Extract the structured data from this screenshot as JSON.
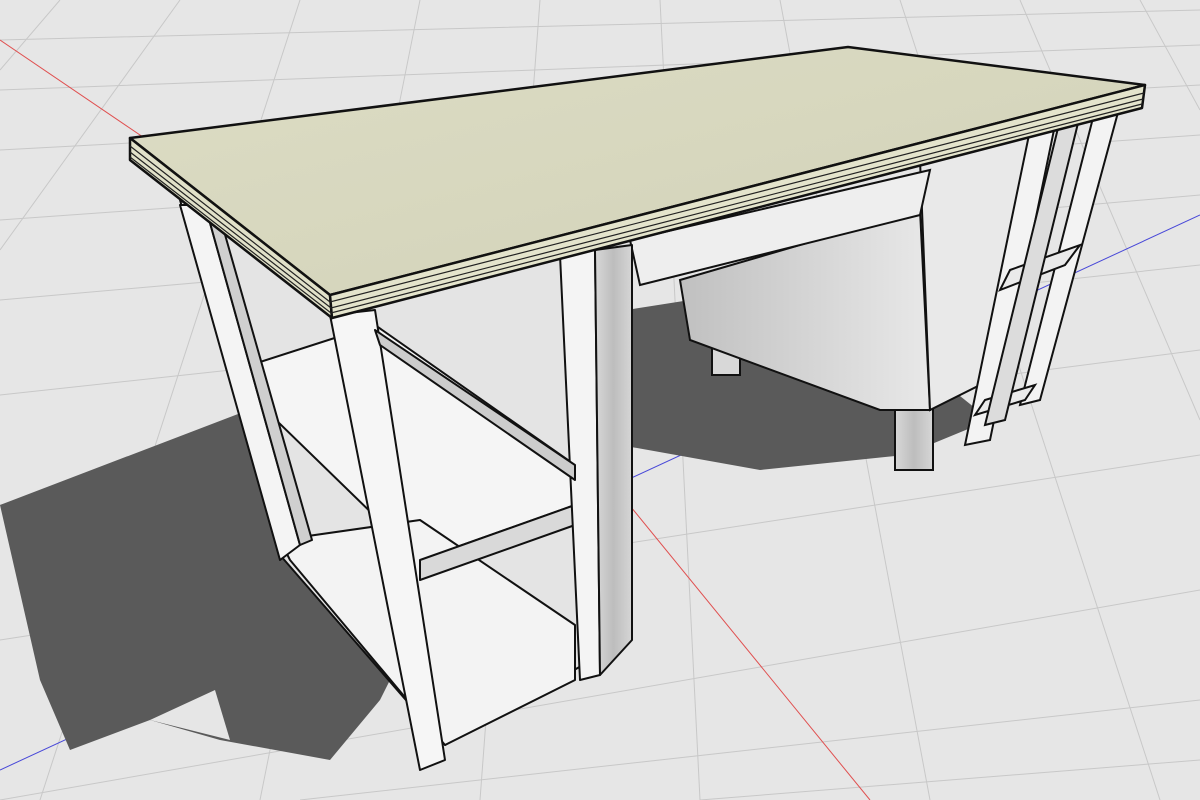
{
  "scene": {
    "object": "desk-model",
    "view": "3d-perspective",
    "colors": {
      "background": "#e6e6e6",
      "grid": "#c9c9c9",
      "axis_red": "#e05050",
      "axis_blue": "#4848d8",
      "shadow": "#595959",
      "desktop": "#d9d9c0",
      "desktop_edge": "#e3e3cc",
      "panel_white": "#f2f2f2",
      "panel_shade": "#cfcfcf",
      "outline": "#111111"
    }
  }
}
